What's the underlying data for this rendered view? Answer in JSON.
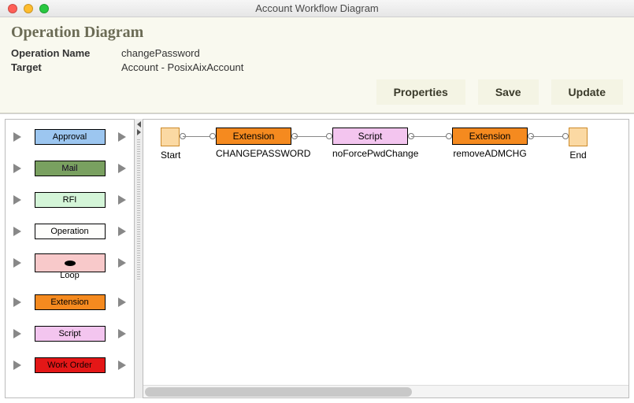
{
  "window": {
    "title": "Account Workflow Diagram"
  },
  "header": {
    "heading": "Operation Diagram",
    "rows": [
      {
        "key": "Operation Name",
        "value": "changePassword"
      },
      {
        "key": "Target",
        "value": "Account - PosixAixAccount"
      }
    ],
    "buttons": {
      "properties": "Properties",
      "save": "Save",
      "update": "Update"
    }
  },
  "palette": [
    {
      "id": "approval",
      "label": "Approval",
      "colorClass": "c-approval"
    },
    {
      "id": "mail",
      "label": "Mail",
      "colorClass": "c-mail"
    },
    {
      "id": "rfi",
      "label": "RFI",
      "colorClass": "c-rfi"
    },
    {
      "id": "operation",
      "label": "Operation",
      "colorClass": "c-operation"
    },
    {
      "id": "loop",
      "label": "Loop",
      "colorClass": "c-loop",
      "isLoop": true
    },
    {
      "id": "extension",
      "label": "Extension",
      "colorClass": "c-extension"
    },
    {
      "id": "script",
      "label": "Script",
      "colorClass": "c-script"
    },
    {
      "id": "workorder",
      "label": "Work Order",
      "colorClass": "c-workorder"
    }
  ],
  "flow": {
    "start": {
      "label": "Start"
    },
    "end": {
      "label": "End"
    },
    "steps": [
      {
        "type": "Extension",
        "caption": "CHANGEPASSWORD",
        "colorClass": "c-extension"
      },
      {
        "type": "Script",
        "caption": "noForcePwdChange",
        "colorClass": "c-script"
      },
      {
        "type": "Extension",
        "caption": "removeADMCHG",
        "colorClass": "c-extension"
      }
    ]
  }
}
